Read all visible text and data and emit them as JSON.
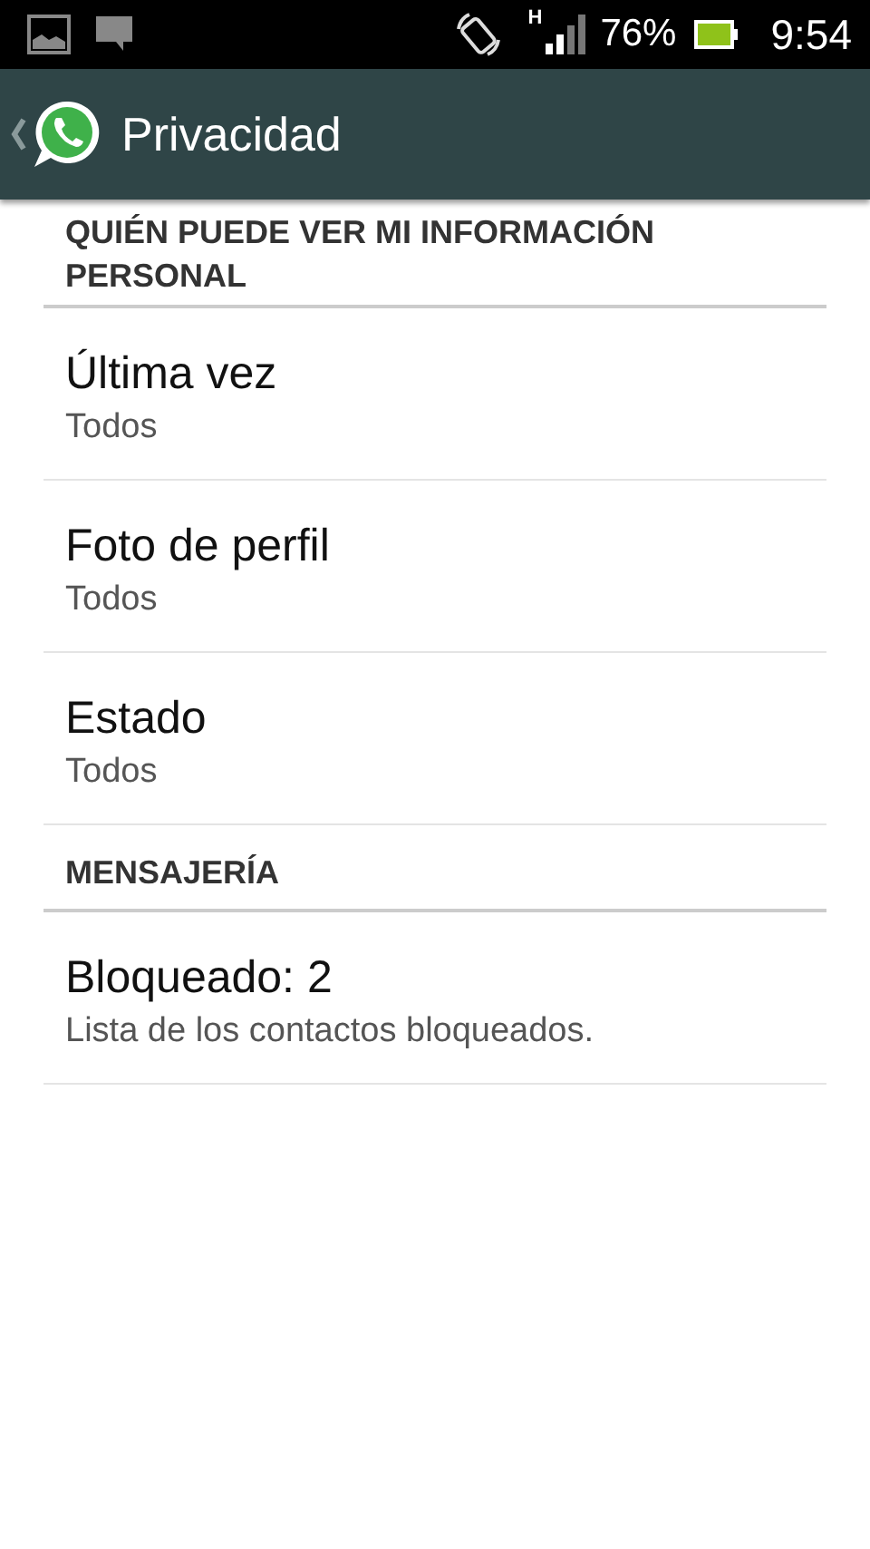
{
  "status_bar": {
    "network": "H",
    "battery": "76%",
    "time": "9:54"
  },
  "action_bar": {
    "title": "Privacidad"
  },
  "sections": [
    {
      "header": "QUIÉN PUEDE VER MI INFORMACIÓN PERSONAL",
      "items": [
        {
          "title": "Última vez",
          "subtitle": "Todos"
        },
        {
          "title": "Foto de perfil",
          "subtitle": "Todos"
        },
        {
          "title": "Estado",
          "subtitle": "Todos"
        }
      ]
    },
    {
      "header": "MENSAJERÍA",
      "items": [
        {
          "title": "Bloqueado: 2",
          "subtitle": "Lista de los contactos bloqueados."
        }
      ]
    }
  ]
}
